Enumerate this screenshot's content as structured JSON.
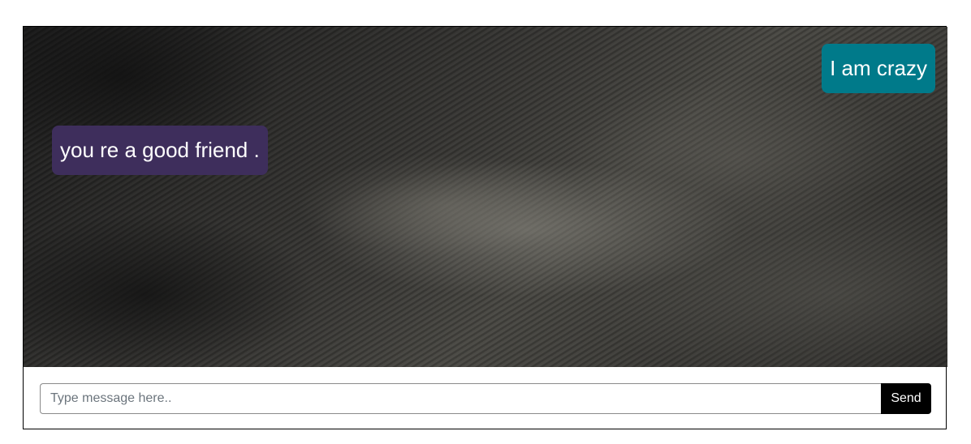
{
  "chat": {
    "messages": [
      {
        "direction": "sent",
        "text": "I am crazy",
        "color": "#007a8a"
      },
      {
        "direction": "received",
        "text": "you re a good friend .",
        "color": "#3e2e5c"
      }
    ],
    "background": "dark-grunge-texture"
  },
  "composer": {
    "placeholder": "Type message here..",
    "value": "",
    "send_label": "Send",
    "send_color": "#000000"
  }
}
